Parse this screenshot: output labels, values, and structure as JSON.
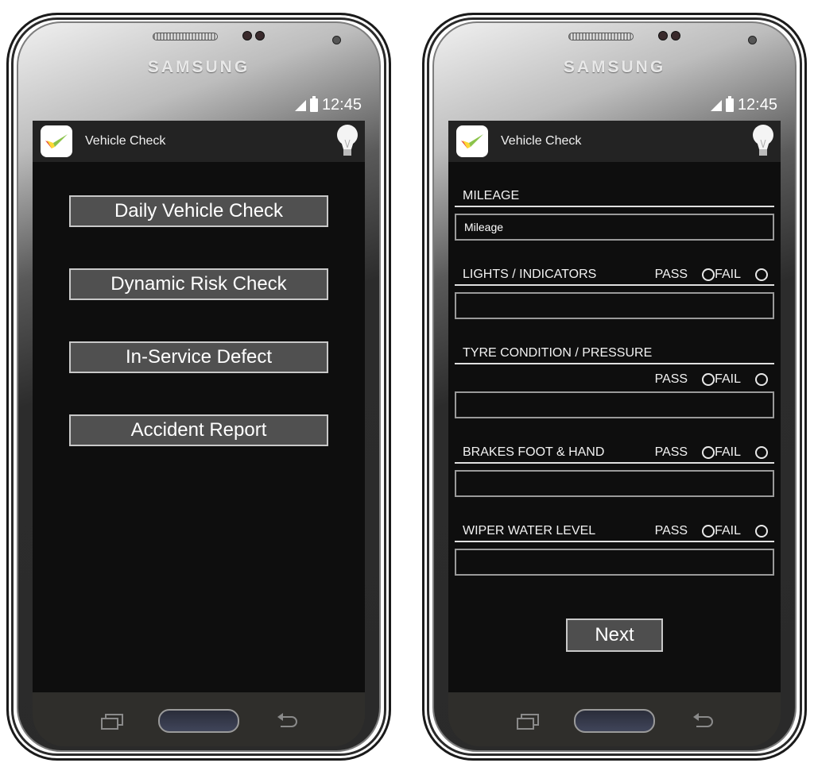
{
  "device": {
    "brand": "SAMSUNG",
    "time": "12:45"
  },
  "app": {
    "title": "Vehicle Check"
  },
  "home_screen": {
    "menu": [
      {
        "label": "Daily Vehicle Check"
      },
      {
        "label": "Dynamic Risk Check"
      },
      {
        "label": "In-Service Defect"
      },
      {
        "label": "Accident Report"
      }
    ]
  },
  "check_screen": {
    "mileage": {
      "label": "MILEAGE",
      "placeholder": "Mileage"
    },
    "pass_label": "PASS",
    "fail_label": "FAIL",
    "sections": [
      {
        "label": "LIGHTS / INDICATORS",
        "pass": false,
        "fail": false
      },
      {
        "label": "TYRE CONDITION / PRESSURE",
        "pass": false,
        "fail": false
      },
      {
        "label": "BRAKES FOOT  & HAND",
        "pass": false,
        "fail": false
      },
      {
        "label": "WIPER WATER LEVEL",
        "pass": false,
        "fail": false
      }
    ],
    "next_label": "Next"
  },
  "icons": {
    "app": "checkmark-logo-icon",
    "hint": "lightbulb-icon",
    "signal": "signal-icon",
    "battery": "battery-icon",
    "recents": "recents-icon",
    "home": "home-button",
    "back": "back-icon"
  }
}
